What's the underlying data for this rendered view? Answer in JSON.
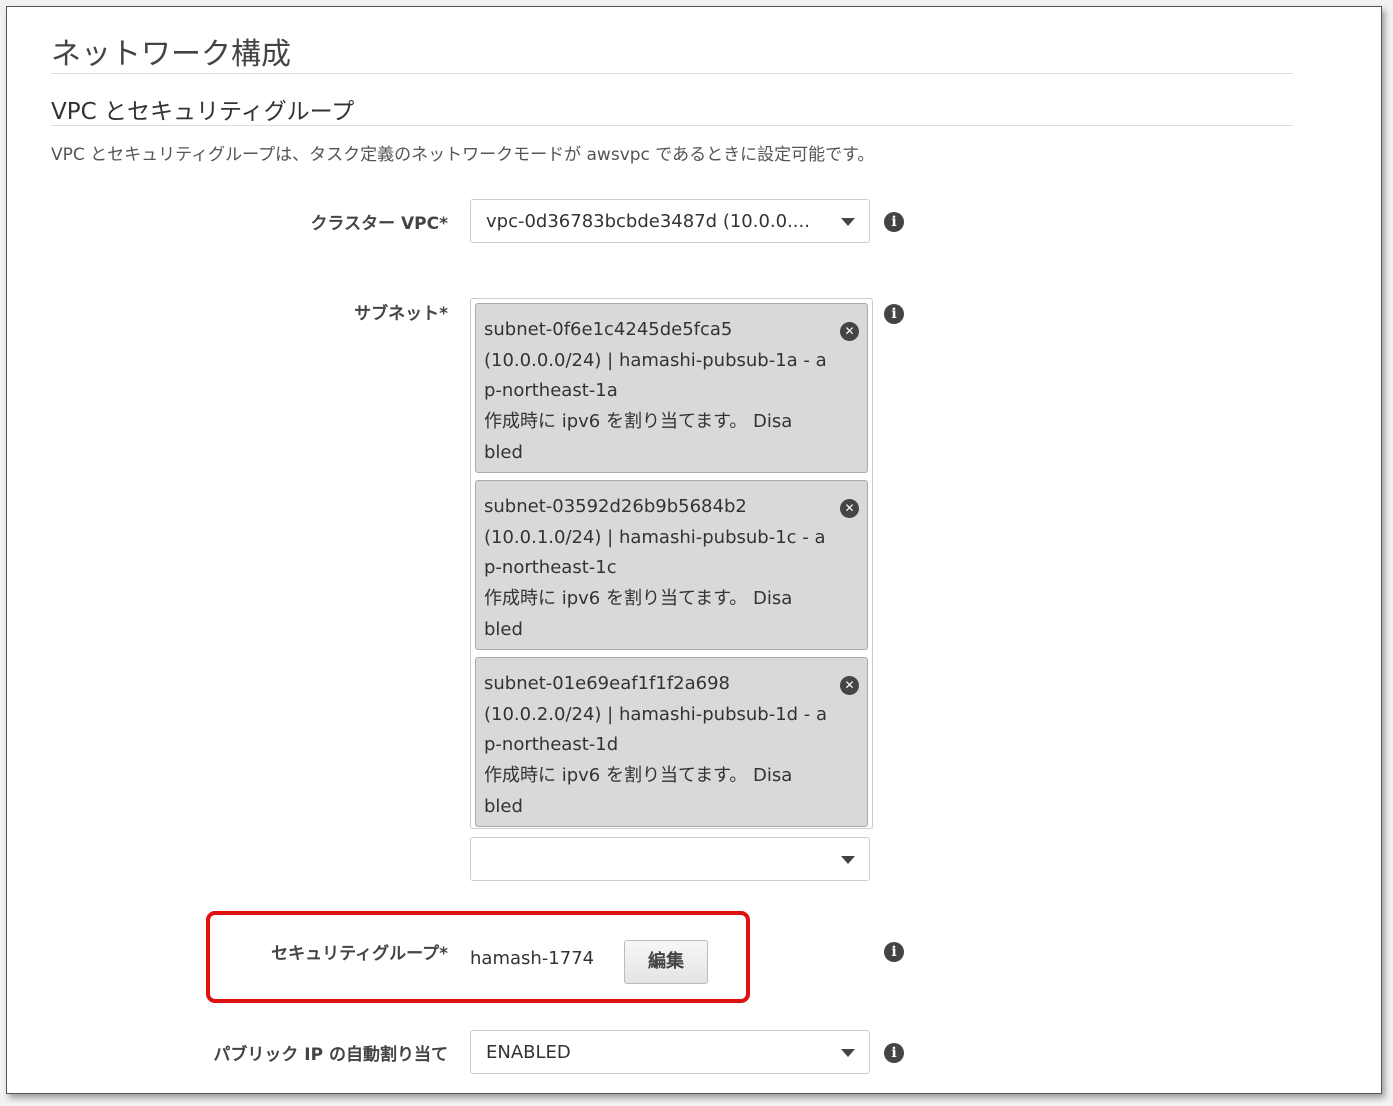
{
  "page_title": "ネットワーク構成",
  "section": {
    "title": "VPC とセキュリティグループ",
    "description": "VPC とセキュリティグループは、タスク定義のネットワークモードが awsvpc であるときに設定可能です。"
  },
  "cluster_vpc": {
    "label": "クラスター VPC*",
    "value": "vpc-0d36783bcbde3487d (10.0.0...."
  },
  "subnets": {
    "label": "サブネット*",
    "items": [
      {
        "text": "subnet-0f6e1c4245de5fca5\n(10.0.0.0/24) | hamashi-pubsub-1a - a\np-northeast-1a\n作成時に ipv6 を割り当てます。 Disa\nbled"
      },
      {
        "text": "subnet-03592d26b9b5684b2\n(10.0.1.0/24) | hamashi-pubsub-1c - a\np-northeast-1c\n作成時に ipv6 を割り当てます。 Disa\nbled"
      },
      {
        "text": "subnet-01e69eaf1f1f2a698\n(10.0.2.0/24) | hamashi-pubsub-1d - a\np-northeast-1d\n作成時に ipv6 を割り当てます。 Disa\nbled"
      }
    ],
    "add_placeholder": ""
  },
  "security_group": {
    "label": "セキュリティグループ*",
    "value": "hamash-1774",
    "edit_label": "編集"
  },
  "public_ip": {
    "label": "パブリック IP の自動割り当て",
    "value": "ENABLED"
  },
  "icons": {
    "info_glyph": "i",
    "remove_glyph": "✕"
  },
  "colors": {
    "highlight": "#e01010",
    "chip_bg": "#d9d9d9"
  }
}
